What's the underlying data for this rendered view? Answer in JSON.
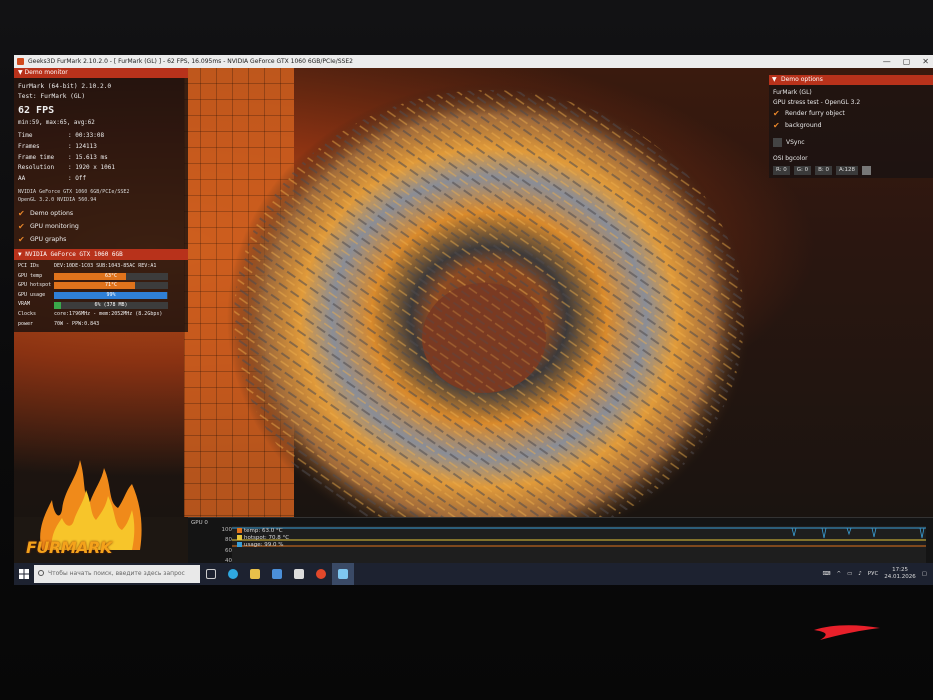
{
  "window": {
    "title": "Geeks3D FurMark 2.10.2.0 - [ FurMark (GL) ] - 62 FPS, 16.095ms - NVIDIA GeForce GTX 1060 6GB/PCIe/SSE2",
    "controls": [
      "—",
      "▢",
      "✕"
    ]
  },
  "demo_monitor": {
    "header": "Demo monitor",
    "app_line": "FurMark (64-bit) 2.10.2.0",
    "test_line": "Test: FurMark (GL)",
    "fps": "62 FPS",
    "stats": "min:59, max:65, avg:62",
    "rows": [
      {
        "key": "Time",
        "value": ": 00:33:08"
      },
      {
        "key": "Frames",
        "value": ": 124113"
      },
      {
        "key": "Frame time",
        "value": ": 15.613 ms"
      },
      {
        "key": "Resolution",
        "value": ": 1920 x 1061"
      },
      {
        "key": "AA",
        "value": ": Off"
      }
    ],
    "gpu_name": "NVIDIA GeForce GTX 1060 6GB/PCIe/SSE2",
    "driver": "OpenGL 3.2.0 NVIDIA 560.94",
    "checks": [
      {
        "label": "Demo options",
        "checked": true
      },
      {
        "label": "GPU monitoring",
        "checked": true
      },
      {
        "label": "GPU graphs",
        "checked": true
      }
    ]
  },
  "gpu_panel": {
    "header": "NVIDIA GeForce GTX 1060 6GB",
    "pci_key": "PCI IDs",
    "pci_value": "DEV:10DE-1C03 SUB:1043-85AC REV:A1",
    "bars": [
      {
        "key": "GPU temp",
        "text": "63°C",
        "level": 0.63,
        "color": "#e0731c"
      },
      {
        "key": "GPU hotspot",
        "text": "71°C",
        "level": 0.71,
        "color": "#e0731c"
      },
      {
        "key": "GPU usage",
        "text": "99%",
        "level": 0.99,
        "color": "#2f7fd6"
      },
      {
        "key": "VRAM",
        "text": "6% (378 MB)",
        "level": 0.06,
        "color": "#3aa84a"
      }
    ],
    "clocks_key": "Clocks",
    "clocks_value": "core:1796MHz - mem:2052MHz (8.2Gbps)",
    "power_key": "power",
    "power_value": "70W - PPW:0.843"
  },
  "logo": {
    "text": "FURMARK"
  },
  "demo_options": {
    "header": "Demo options",
    "subtitle1": "FurMark (GL)",
    "subtitle2": "GPU stress test - OpenGL 3.2",
    "checks": [
      {
        "label": "Render furry object",
        "checked": true
      },
      {
        "label": "background",
        "checked": true
      }
    ],
    "vsync_label": "VSync",
    "bgcolor_label": "OSI bgcolor",
    "chips": [
      "R: 0",
      "G: 0",
      "B: 0",
      "A:128"
    ]
  },
  "graph": {
    "title": "GPU 0",
    "y_ticks": [
      "100",
      "80",
      "60",
      "40"
    ],
    "legend": [
      {
        "label": "temp: 63.0 °C",
        "color": "#e0731c"
      },
      {
        "label": "hotspot: 70.8 °C",
        "color": "#e6c63a"
      },
      {
        "label": "usage: 99.0 %",
        "color": "#3a9fd6"
      }
    ]
  },
  "taskbar": {
    "search_placeholder": "Чтобы начать поиск, введите здесь запрос",
    "lang": "РУС",
    "time": "17:25",
    "date": "24.01.2026"
  }
}
